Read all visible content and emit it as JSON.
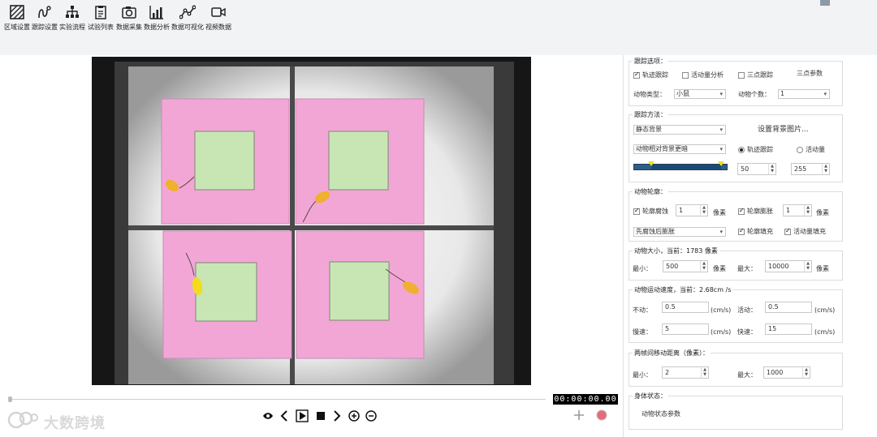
{
  "toolbar": {
    "items": [
      {
        "label": "区域设置",
        "icon": "area-hatch-icon"
      },
      {
        "label": "跟踪设置",
        "icon": "tracking-path-icon"
      },
      {
        "label": "实验流程",
        "icon": "flowchart-icon"
      },
      {
        "label": "试验列表",
        "icon": "clipboard-list-icon"
      },
      {
        "label": "数据采集",
        "icon": "camera-icon"
      },
      {
        "label": "数据分析",
        "icon": "bar-chart-icon"
      },
      {
        "label": "数据可视化",
        "icon": "line-graph-icon"
      },
      {
        "label": "视频数据",
        "icon": "video-camera-icon"
      }
    ]
  },
  "player": {
    "timecode": "00:00:00.00",
    "brand_text": "大数跨境",
    "seek_progress": 0.0
  },
  "panel": {
    "tracking_options": {
      "title": "跟踪选项：",
      "edge_tracking": "轨迹跟踪",
      "edge_tracking_checked": true,
      "activity_analysis": "活动量分析",
      "activity_analysis_checked": false,
      "three_point": "三点跟踪",
      "three_point_checked": false,
      "three_point_params": "三点参数",
      "animal_type_label": "动物类型：",
      "animal_type_value": "小鼠",
      "animal_count_label": "动物个数：",
      "animal_count_value": "1"
    },
    "tracking_method": {
      "title": "跟踪方法：",
      "method_value": "静态背景",
      "set_bg_button": "设置背景图片...",
      "contrast_value": "动物相对背景更暗",
      "radio_track": "轨迹跟踪",
      "radio_track_on": true,
      "radio_activity": "活动量",
      "radio_activity_on": false,
      "threshold_low": "50",
      "threshold_high": "255"
    },
    "contour": {
      "title": "动物轮廓：",
      "erode_label": "轮廓腐蚀",
      "erode_checked": true,
      "erode_value": "1",
      "erode_unit": "像素",
      "dilate_label": "轮廓膨胀",
      "dilate_checked": true,
      "dilate_value": "1",
      "dilate_unit": "像素",
      "order_value": "先腐蚀后膨胀",
      "fill_label": "轮廓填充",
      "fill_checked": true,
      "activity_fill_label": "活动量填充",
      "activity_fill_checked": true
    },
    "size": {
      "title": "动物大小，当前：1783 像素",
      "min_label": "最小：",
      "min_value": "500",
      "min_unit": "像素",
      "max_label": "最大：",
      "max_value": "10000",
      "max_unit": "像素"
    },
    "speed": {
      "title": "动物运动速度，当前：2.68cm /s",
      "still_label": "不动：",
      "still_value": "0.5",
      "still_unit": "(cm/s)",
      "active_label": "活动：",
      "active_value": "0.5",
      "active_unit": "(cm/s)",
      "slow_label": "慢速：",
      "slow_value": "5",
      "slow_unit": "(cm/s)",
      "fast_label": "快速：",
      "fast_value": "15",
      "fast_unit": "(cm/s)"
    },
    "distance": {
      "title": "两帧间移动距离（像素）：",
      "min_label": "最小：",
      "min_value": "2",
      "max_label": "最大：",
      "max_value": "1000"
    },
    "body_state": {
      "title": "身体状态：",
      "params_button": "动物状态参数"
    }
  },
  "colors": {
    "zone_pink": "#f2a6d6",
    "zone_green": "#c8e6b4",
    "animal_orange": "#f0b030",
    "animal_yellow": "#f2dc1e",
    "slider_blue": "#2f5d86"
  }
}
